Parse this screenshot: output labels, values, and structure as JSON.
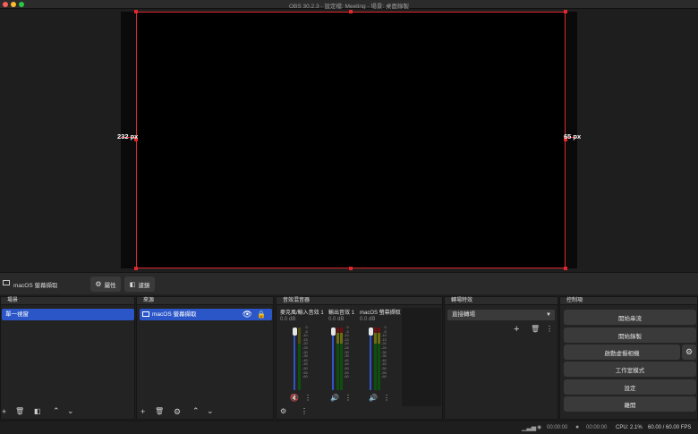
{
  "window": {
    "title": "OBS 30.2.3 - 設定檔: Meeting - 場景: 桌面錄製"
  },
  "preview": {
    "left_margin_label": "232 px",
    "right_margin_label": "65 px"
  },
  "context_bar": {
    "source_name": "macOS 螢幕擷取",
    "properties_label": "屬性",
    "filters_label": "濾鏡"
  },
  "scenes": {
    "title": "場景",
    "items": [
      "單一視窗"
    ]
  },
  "sources": {
    "title": "來源",
    "items": [
      "macOS 螢幕擷取"
    ]
  },
  "mixer": {
    "title": "音效混音器",
    "channels": [
      {
        "name": "麥克風/輸入音效 1",
        "db": "0.0 dB",
        "muted": true
      },
      {
        "name": "輸出音效 1",
        "db": "0.0 dB",
        "muted": false
      },
      {
        "name": "macOS 螢幕擷取",
        "db": "0.0 dB",
        "muted": false
      }
    ],
    "scale": [
      "0",
      "-5",
      "-10",
      "-15",
      "-20",
      "-25",
      "-30",
      "-35",
      "-40",
      "-45",
      "-50",
      "-55",
      "-60"
    ]
  },
  "transitions": {
    "title": "轉場特效",
    "selected": "直接轉場"
  },
  "controls": {
    "title": "控制項",
    "start_stream": "開始串流",
    "start_record": "開始錄製",
    "virtual_cam": "啟動虛擬相機",
    "studio_mode": "工作室模式",
    "settings": "設定",
    "exit": "離開"
  },
  "status": {
    "stream_time": "00:00:00",
    "record_time": "00:00:00",
    "cpu": "CPU: 2.1%",
    "fps": "60.00 / 60.00 FPS"
  },
  "colors": {
    "accent": "#2b56c8",
    "bounding_box": "#e0282e",
    "meter_green": "#0e4f0e"
  }
}
